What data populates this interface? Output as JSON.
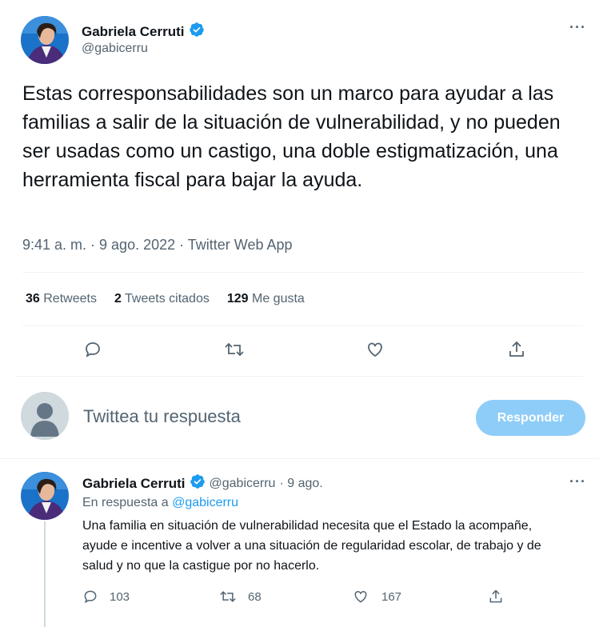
{
  "main_tweet": {
    "author_name": "Gabriela Cerruti",
    "author_handle": "@gabicerru",
    "text": "Estas corresponsabilidades son un marco para ayudar a las familias a salir de la situación de vulnerabilidad, y no pueden ser usadas como un castigo, una doble estigmatización, una herramienta fiscal para bajar la ayuda.",
    "meta": "9:41 a. m. · 9 ago. 2022 · Twitter Web App",
    "stats": {
      "retweets_count": "36",
      "retweets_label": "Retweets",
      "quotes_count": "2",
      "quotes_label": "Tweets citados",
      "likes_count": "129",
      "likes_label": "Me gusta"
    }
  },
  "reply_composer": {
    "placeholder": "Twittea tu respuesta",
    "button_label": "Responder"
  },
  "reply_tweet": {
    "author_name": "Gabriela Cerruti",
    "author_handle": "@gabicerru",
    "date": "· 9 ago.",
    "in_reply_prefix": "En respuesta a",
    "in_reply_handle": "@gabicerru",
    "text": "Una familia en situación de vulnerabilidad necesita que el Estado la acompañe, ayude e incentive a volver a una situación de regularidad escolar, de trabajo y de salud y no que la castigue por no hacerlo.",
    "replies": "103",
    "retweets": "68",
    "likes": "167"
  },
  "colors": {
    "accent": "#1d9bf0",
    "button_disabled": "#8ecdf8",
    "secondary_text": "#536471"
  },
  "icons": [
    "verified-badge-icon",
    "more-icon",
    "reply-icon",
    "retweet-icon",
    "like-icon",
    "share-icon",
    "default-avatar-icon"
  ]
}
